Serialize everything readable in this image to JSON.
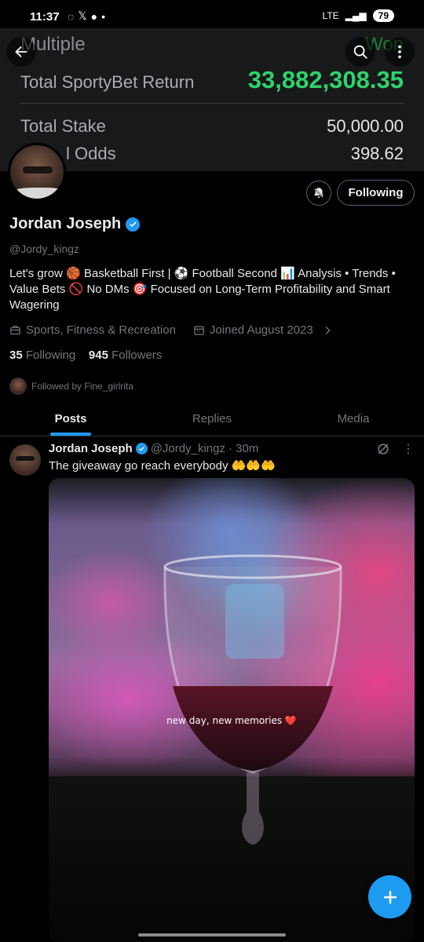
{
  "status_bar": {
    "time": "11:37",
    "network": "LTE",
    "battery": "79"
  },
  "banner": {
    "title": "Multiple",
    "status": "Won",
    "return_label": "Total SportyBet Return",
    "return_value": "33,882,308.35",
    "stake_label": "Total Stake",
    "stake_value": "50,000.00",
    "odds_label": "l Odds",
    "odds_value": "398.62"
  },
  "profile": {
    "name": "Jordan Joseph",
    "handle": "@Jordy_kingz",
    "bio": "Let's grow  🏀 Basketball First | ⚽ Football Second 📊 Analysis • Trends • Value Bets 🚫 No DMs 🎯 Focused on Long-Term Profitability and Smart Wagering",
    "category": "Sports, Fitness & Recreation",
    "joined": "Joined August 2023",
    "following_count": "35",
    "following_label": "Following",
    "followers_count": "945",
    "followers_label": "Followers",
    "followed_by": "Followed by Fine_girlrita",
    "follow_button": "Following"
  },
  "tabs": [
    "Posts",
    "Replies",
    "Media"
  ],
  "post": {
    "name": "Jordan Joseph",
    "handle": "@Jordy_kingz",
    "time": "· 30m",
    "text": "The giveaway go reach everybody 🤲🤲🤲",
    "media_caption": "new day, new memories ❤️"
  },
  "colors": {
    "accent": "#1d9bf0",
    "won_green": "#2fd36b",
    "background": "#000000"
  }
}
